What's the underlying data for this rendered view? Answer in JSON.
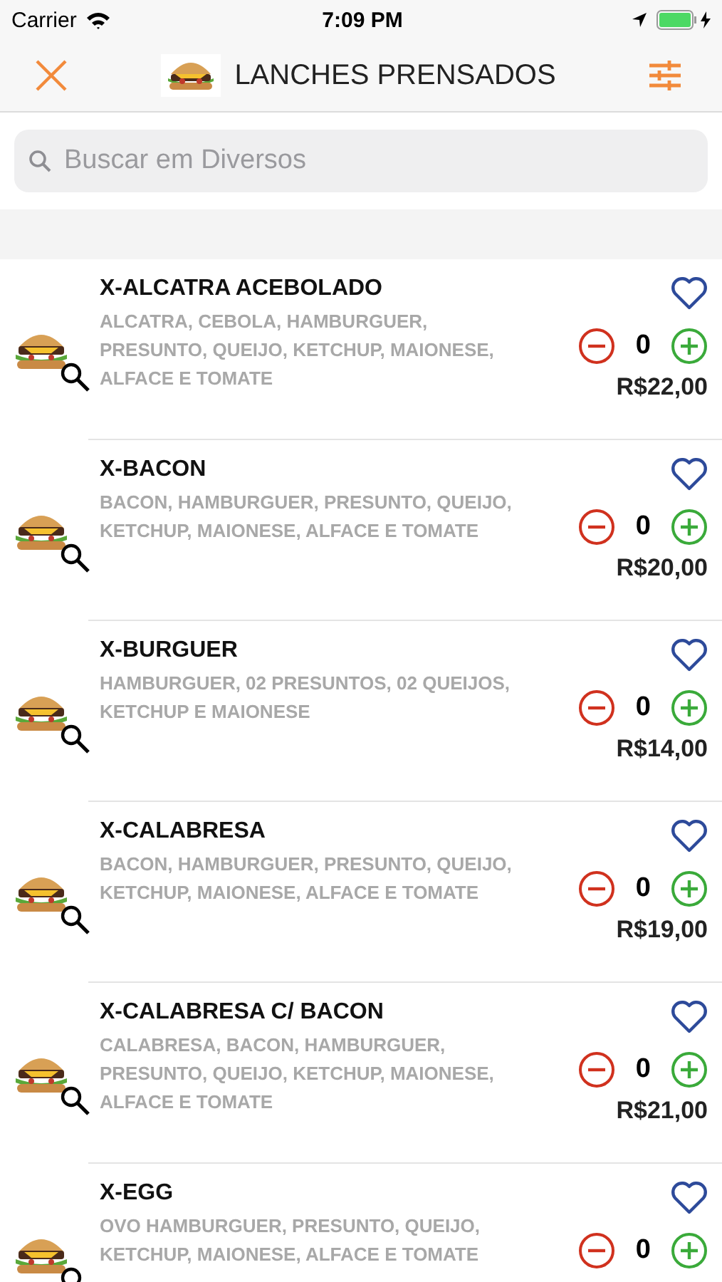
{
  "status_bar": {
    "carrier": "Carrier",
    "time": "7:09 PM"
  },
  "nav": {
    "title": "LANCHES PRENSADOS"
  },
  "search": {
    "placeholder": "Buscar em Diversos"
  },
  "items": [
    {
      "name": "X-ALCATRA ACEBOLADO",
      "description": "ALCATRA, CEBOLA, HAMBURGUER, PRESUNTO, QUEIJO, KETCHUP, MAIONESE, ALFACE E TOMATE",
      "quantity": "0",
      "price": "R$22,00"
    },
    {
      "name": "X-BACON",
      "description": "BACON, HAMBURGUER, PRESUNTO, QUEIJO, KETCHUP, MAIONESE, ALFACE E TOMATE",
      "quantity": "0",
      "price": "R$20,00"
    },
    {
      "name": "X-BURGUER",
      "description": "HAMBURGUER, 02 PRESUNTOS, 02 QUEIJOS, KETCHUP E MAIONESE",
      "quantity": "0",
      "price": "R$14,00"
    },
    {
      "name": "X-CALABRESA",
      "description": "BACON, HAMBURGUER, PRESUNTO, QUEIJO, KETCHUP, MAIONESE, ALFACE E TOMATE",
      "quantity": "0",
      "price": "R$19,00"
    },
    {
      "name": "X-CALABRESA C/ BACON",
      "description": "CALABRESA, BACON, HAMBURGUER, PRESUNTO, QUEIJO, KETCHUP, MAIONESE, ALFACE E TOMATE",
      "quantity": "0",
      "price": "R$21,00"
    },
    {
      "name": "X-EGG",
      "description": "OVO HAMBURGUER, PRESUNTO, QUEIJO, KETCHUP, MAIONESE, ALFACE E TOMATE",
      "quantity": "0"
    }
  ]
}
